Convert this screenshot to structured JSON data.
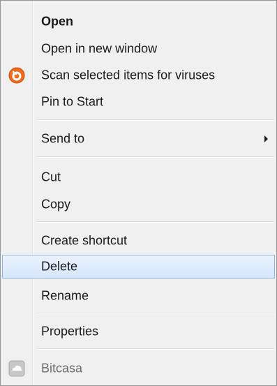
{
  "menu": {
    "items": [
      {
        "label": "Open",
        "icon": "",
        "bold": true
      },
      {
        "label": "Open in new window",
        "icon": ""
      },
      {
        "label": "Scan selected items for viruses",
        "icon": "avast-antivirus-icon"
      },
      {
        "label": "Pin to Start",
        "icon": ""
      },
      {
        "label": "Send to",
        "icon": "",
        "submenu": true
      },
      {
        "label": "Cut",
        "icon": ""
      },
      {
        "label": "Copy",
        "icon": ""
      },
      {
        "label": "Create shortcut",
        "icon": ""
      },
      {
        "label": "Delete",
        "icon": "",
        "selected": true
      },
      {
        "label": "Rename",
        "icon": ""
      },
      {
        "label": "Properties",
        "icon": ""
      },
      {
        "label": "Bitcasa",
        "icon": "bitcasa-cloud-icon",
        "disabled": true
      }
    ]
  },
  "colors": {
    "menu_background": "#f0f0f0",
    "selection_border": "#8fb8e6",
    "selection_fill": "#d5e6fa",
    "avast_orange": "#f26a1b"
  }
}
